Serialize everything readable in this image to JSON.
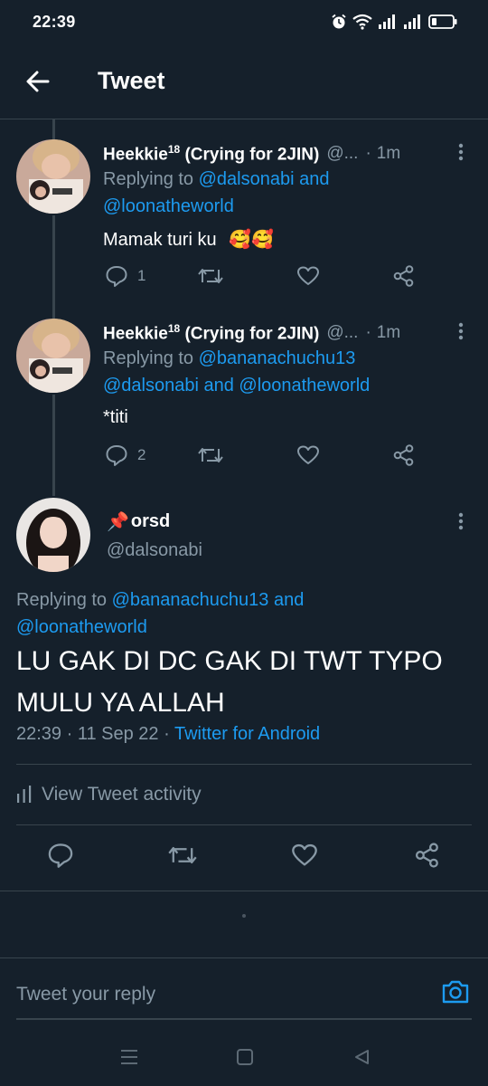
{
  "status_bar": {
    "time": "22:39"
  },
  "header": {
    "title": "Tweet"
  },
  "replies": [
    {
      "display_name": "Heekkie",
      "display_name_sup": "18",
      "display_name_suffix": " (Crying for 2JIN)",
      "handle": "@...",
      "separator": "·",
      "time_ago": "1m",
      "replying_prefix": "Replying to ",
      "replying_line1_mention": "@dalsonabi",
      "replying_line1_and": " and",
      "replying_line2_mention": "@loonatheworld",
      "replying_line2_and": "",
      "text": "Mamak turi ku",
      "emoji": "🥰🥰",
      "reply_count": "1",
      "retweet_count": "",
      "like_count": ""
    },
    {
      "display_name": "Heekkie",
      "display_name_sup": "18",
      "display_name_suffix": " (Crying for 2JIN)",
      "handle": "@...",
      "separator": "·",
      "time_ago": "1m",
      "replying_prefix": "Replying to ",
      "replying_line1_mention": "@bananachuchu13",
      "replying_line1_and": "",
      "replying_line2_mention": "@dalsonabi",
      "replying_line2_and": " and ",
      "replying_line2_mention_b": "@loonatheworld",
      "text": "*titi",
      "emoji": "",
      "reply_count": "2",
      "retweet_count": "",
      "like_count": ""
    }
  ],
  "main_tweet": {
    "pin_emoji": "📌",
    "display_name": "orsd",
    "handle": "@dalsonabi",
    "replying_prefix": "Replying to ",
    "replying_mention1": "@bananachuchu13",
    "replying_and": " and",
    "replying_mention2": "@loonatheworld",
    "text": "LU GAK DI DC GAK DI TWT TYPO MULU YA ALLAH",
    "time": "22:39",
    "separator1": " · ",
    "date": "11 Sep 22",
    "separator2": " · ",
    "source": "Twitter for Android"
  },
  "activity": {
    "label": "View Tweet activity"
  },
  "reply_bar": {
    "placeholder": "Tweet your reply"
  },
  "colors": {
    "background": "#15202b",
    "accent": "#1d9bf0",
    "secondary_text": "#8899a6",
    "divider": "#38444d"
  },
  "icons": {
    "status": [
      "alarm-icon",
      "wifi-icon",
      "signal-icon",
      "signal-icon",
      "battery-icon"
    ],
    "actions": [
      "reply-icon",
      "retweet-icon",
      "like-icon",
      "share-icon"
    ],
    "nav": [
      "recents-icon",
      "home-icon",
      "back-nav-icon"
    ]
  }
}
